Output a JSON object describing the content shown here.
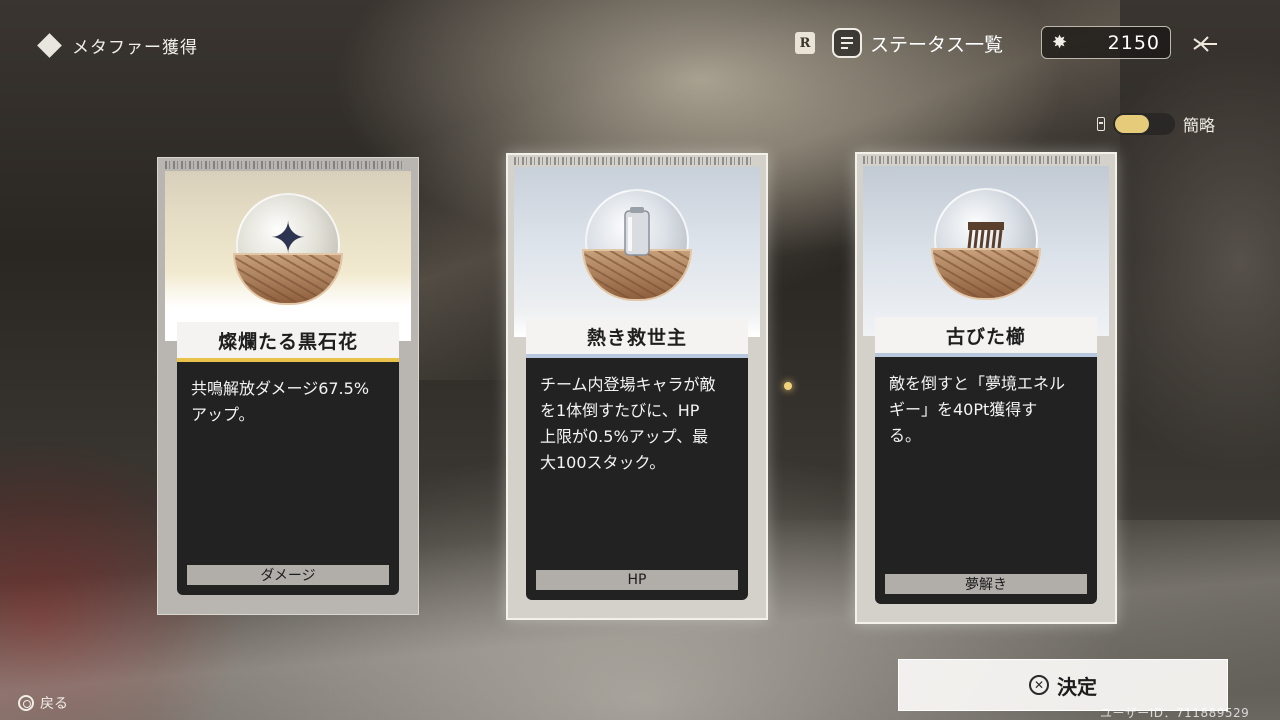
{
  "header": {
    "title": "メタファー獲得",
    "status_button_label": "ステータス一覧",
    "currency_value": "2150",
    "badge_letter": "R",
    "toggle_label": "簡略",
    "toggle_on": true
  },
  "cards": [
    {
      "name": "燦爛たる黒石花",
      "description": "共鳴解放ダメージ67.5%\nアップ。",
      "tag": "ダメージ",
      "accent_color": "#e8c24a",
      "icon": "black-stone-flower-icon",
      "selected": false
    },
    {
      "name": "熱き救世主",
      "description": "チーム内登場キャラが敵\nを1体倒すたびに、HP\n上限が0.5%アップ、最\n大100スタック。",
      "tag": "HP",
      "accent_color": "#b7c8de",
      "icon": "thermos-icon",
      "selected": true
    },
    {
      "name": "古びた櫛",
      "description": "敵を倒すと「夢境エネル\nギー」を40Pt獲得す\nる。",
      "tag": "夢解き",
      "accent_color": "#b7c8de",
      "icon": "old-comb-icon",
      "selected": true
    }
  ],
  "footer": {
    "back_label": "戻る",
    "confirm_label": "決定",
    "user_id": "ユーザーID：711889529"
  }
}
